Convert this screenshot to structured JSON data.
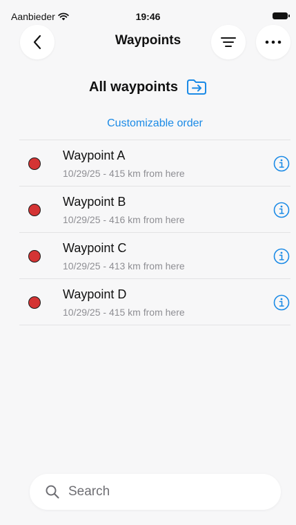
{
  "status": {
    "carrier": "Aanbieder",
    "time": "19:46"
  },
  "nav": {
    "title": "Waypoints",
    "back_icon": "chevron-left-icon",
    "filter_icon": "filter-lines-icon",
    "more_icon": "ellipsis-icon"
  },
  "section": {
    "title": "All waypoints",
    "folder_icon": "folder-arrow-icon"
  },
  "order_link": "Customizable order",
  "colors": {
    "accent": "#1a8ae6",
    "dot": "#d43434"
  },
  "waypoints": [
    {
      "name": "Waypoint A",
      "subtitle": "10/29/25 - 415 km from here"
    },
    {
      "name": "Waypoint B",
      "subtitle": "10/29/25 - 416 km from here"
    },
    {
      "name": "Waypoint C",
      "subtitle": "10/29/25 - 413 km from here"
    },
    {
      "name": "Waypoint D",
      "subtitle": "10/29/25 - 415 km from here"
    }
  ],
  "search": {
    "placeholder": "Search"
  }
}
